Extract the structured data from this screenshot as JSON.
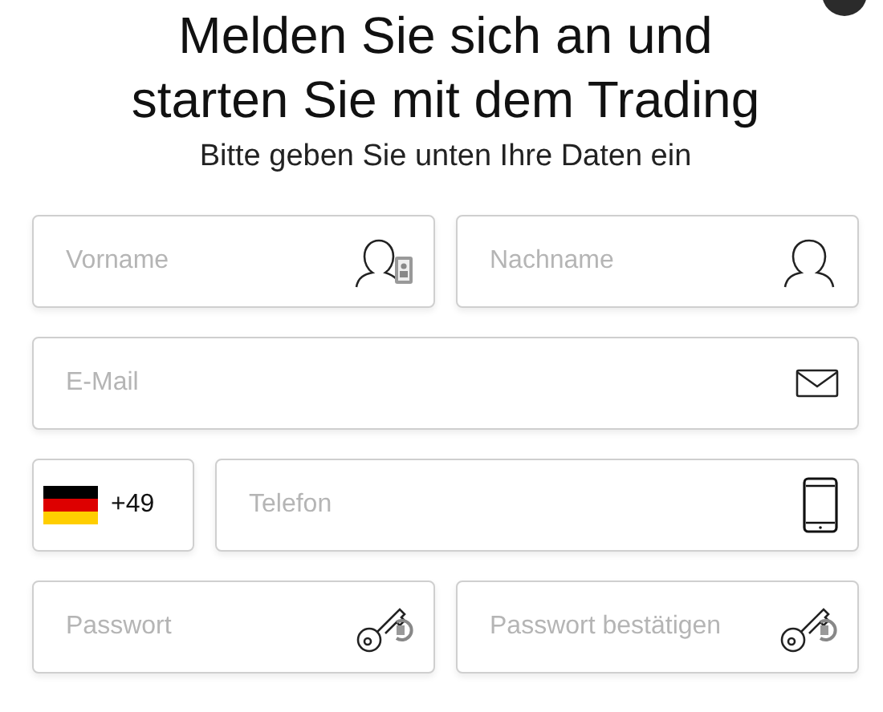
{
  "heading": {
    "lines": [
      "Melden Sie sich an und",
      "starten Sie mit dem Trading"
    ]
  },
  "subtitle": "Bitte geben Sie unten Ihre Daten ein",
  "rows": [
    {
      "fields": [
        {
          "kind": "contact",
          "placeholder": "Vorname"
        },
        {
          "kind": "person",
          "placeholder": "Nachname"
        }
      ]
    },
    {
      "fields": [
        {
          "kind": "email",
          "placeholder": "E-Mail"
        }
      ]
    },
    {
      "country_code": "+49",
      "fields": [
        {
          "kind": "mobile",
          "placeholder": "Telefon"
        }
      ]
    },
    {
      "fields": [
        {
          "kind": "password",
          "placeholder": "Passwort"
        },
        {
          "kind": "password",
          "placeholder": "Passwort bestätigen"
        }
      ]
    }
  ]
}
